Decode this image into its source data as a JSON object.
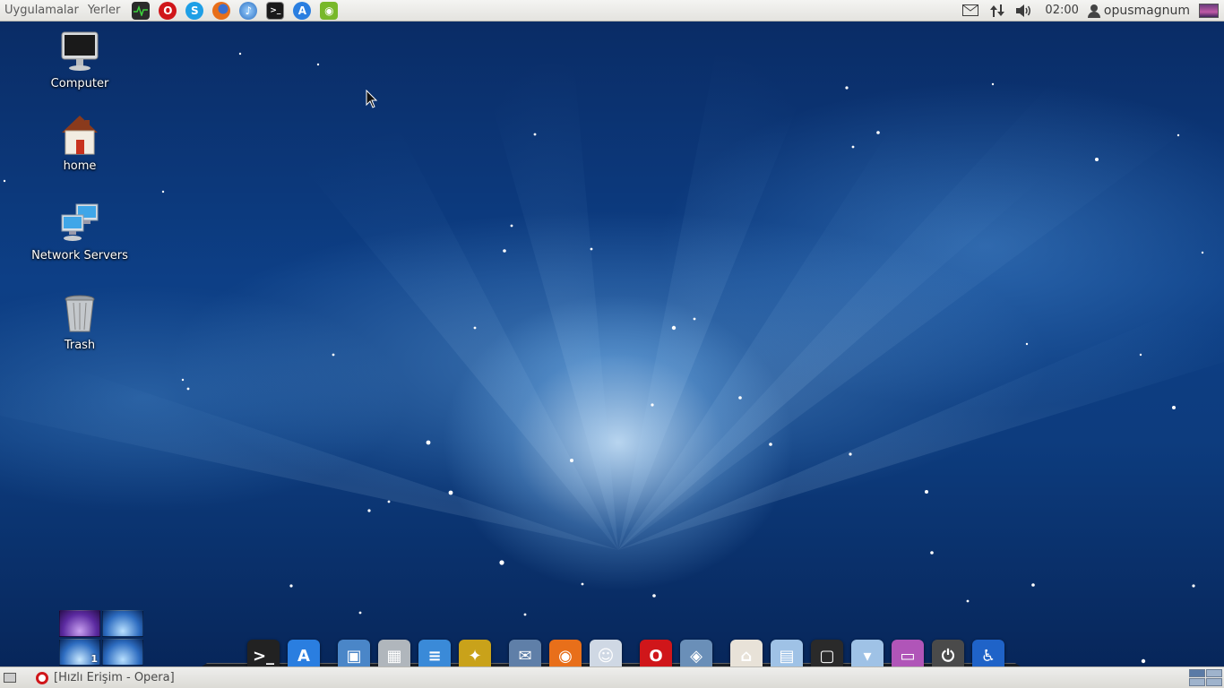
{
  "top_panel": {
    "menus": [
      "Uygulamalar",
      "Yerler"
    ],
    "launchers": [
      {
        "name": "system-monitor-icon",
        "color": "#2b2b2b"
      },
      {
        "name": "opera-icon",
        "color": "#d0161a"
      },
      {
        "name": "skype-icon",
        "color": "#1e9fe6"
      },
      {
        "name": "firefox-icon",
        "color": "#e86f1a"
      },
      {
        "name": "itunes-icon",
        "color": "#3e8ed8"
      },
      {
        "name": "terminal-icon",
        "color": "#1a1a1a"
      },
      {
        "name": "app-store-icon",
        "color": "#2a7ee0"
      },
      {
        "name": "nvidia-icon",
        "color": "#78b82a"
      }
    ],
    "tray": [
      "mail-icon",
      "network-icon",
      "volume-icon"
    ],
    "clock": "02:00",
    "username": "opusmagnum"
  },
  "desktop_icons": [
    {
      "label": "Computer",
      "icon": "computer-icon"
    },
    {
      "label": "home",
      "icon": "home-folder-icon"
    },
    {
      "label": "Network Servers",
      "icon": "network-servers-icon"
    },
    {
      "label": "Trash",
      "icon": "trash-icon"
    }
  ],
  "workspaces": {
    "active_number": "1"
  },
  "dock": [
    {
      "name": "terminal-icon",
      "glyph": ">_",
      "color": "#222222"
    },
    {
      "name": "app-store-icon",
      "glyph": "A",
      "color": "#2a7ee0"
    },
    {
      "sep": true
    },
    {
      "name": "image-viewer-icon",
      "glyph": "▣",
      "color": "#4a86c8"
    },
    {
      "name": "calculator-icon",
      "glyph": "▦",
      "color": "#b0b6bc"
    },
    {
      "name": "text-editor-icon",
      "glyph": "≡",
      "color": "#3a8ad8"
    },
    {
      "name": "photo-app-icon",
      "glyph": "✦",
      "color": "#c9a21a"
    },
    {
      "sep": true
    },
    {
      "name": "mail-app-icon",
      "glyph": "✉",
      "color": "#5f7fa8"
    },
    {
      "name": "firefox-icon",
      "glyph": "◉",
      "color": "#e86f1a"
    },
    {
      "name": "messenger-icon",
      "glyph": "☺",
      "color": "#cfd8e4"
    },
    {
      "sep": true
    },
    {
      "name": "opera-icon",
      "glyph": "O",
      "color": "#d0161a"
    },
    {
      "name": "preview-icon",
      "glyph": "◈",
      "color": "#6a8fb8"
    },
    {
      "sep": true
    },
    {
      "name": "home-folder-icon",
      "glyph": "⌂",
      "color": "#e8e2d8"
    },
    {
      "name": "documents-folder-icon",
      "glyph": "▤",
      "color": "#9fc2e6"
    },
    {
      "name": "applications-folder-icon",
      "glyph": "▢",
      "color": "#2a2a2a"
    },
    {
      "name": "downloads-folder-icon",
      "glyph": "▾",
      "color": "#9fc2e6"
    },
    {
      "name": "desktop-picture-icon",
      "glyph": "▭",
      "color": "#b055b8"
    },
    {
      "name": "power-icon",
      "glyph": "⏻",
      "color": "#4a4a4a"
    },
    {
      "name": "accessibility-icon",
      "glyph": "♿",
      "color": "#1f63c8"
    }
  ],
  "taskbar": {
    "task_title": "[Hızlı Erişim - Opera]"
  }
}
